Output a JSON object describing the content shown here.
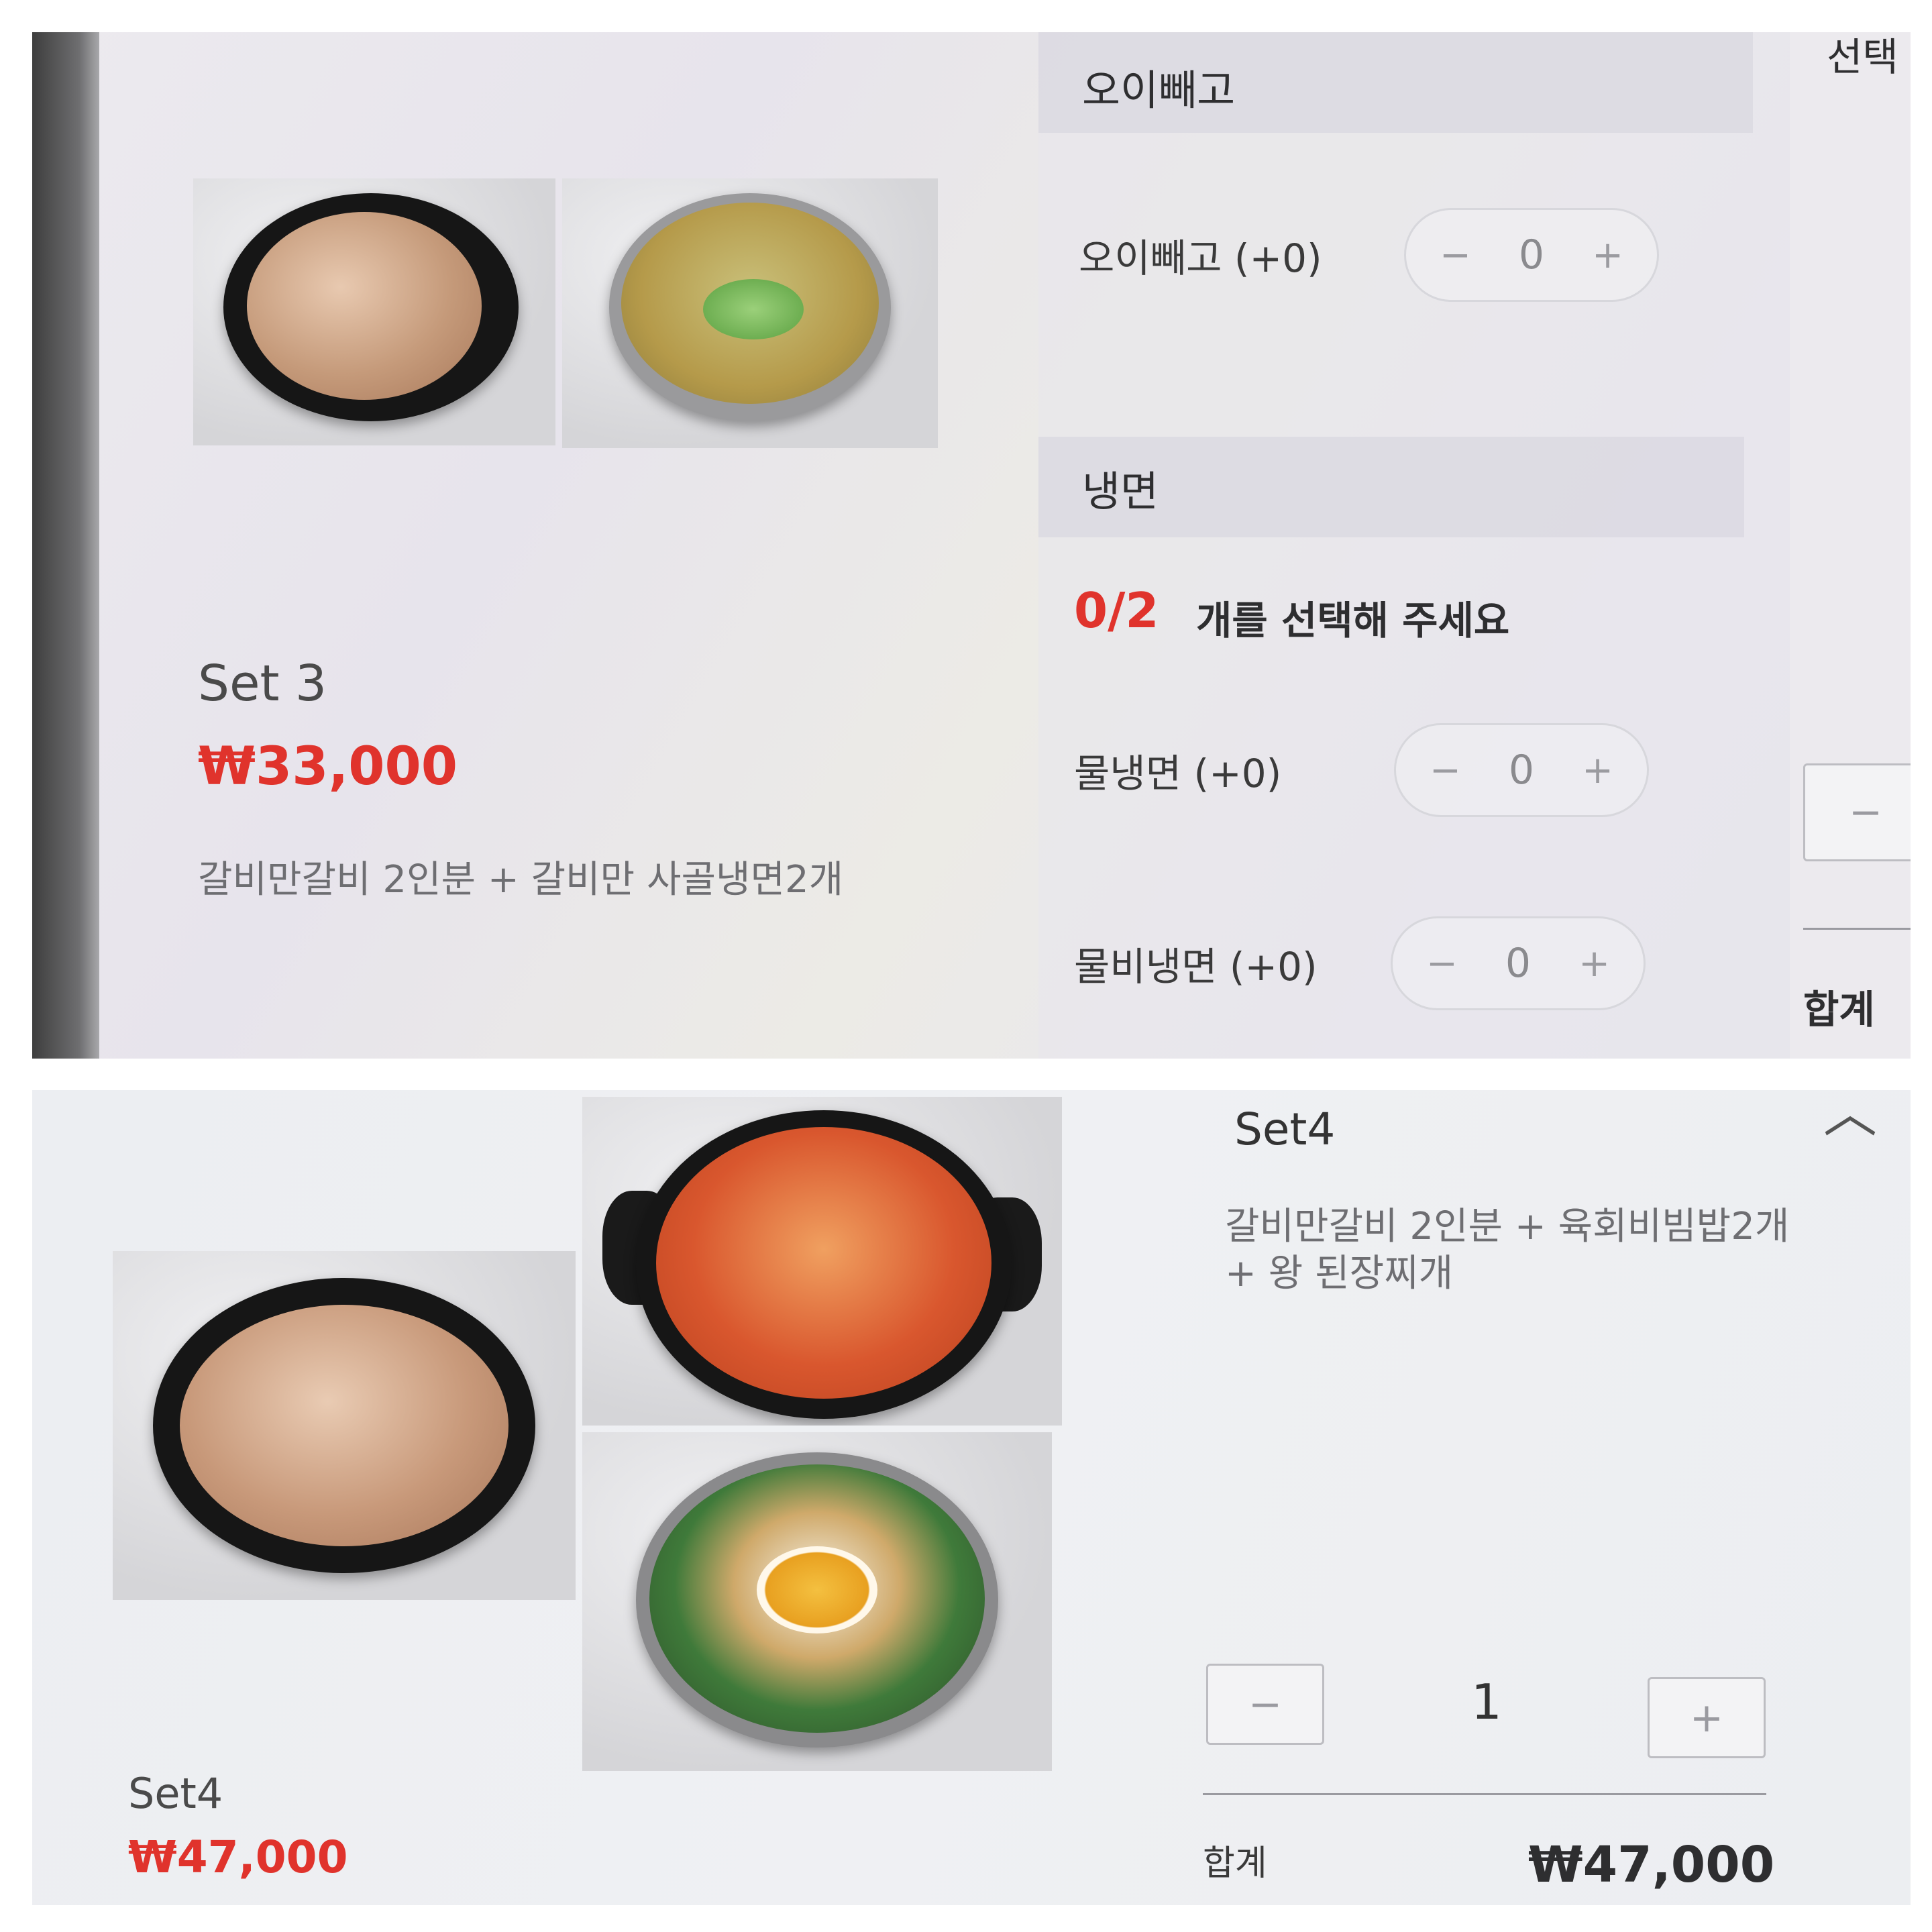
{
  "top": {
    "set_title": "Set 3",
    "set_price": "₩33,000",
    "set_description": "갈비만갈비 2인분 + 갈비만 사골냉면2개",
    "header_clipped": "선택",
    "section1": {
      "header": "오이빼고",
      "options": [
        {
          "label": "오이빼고 (+0)",
          "count": "0"
        }
      ]
    },
    "section2": {
      "header": "냉면",
      "required_count": "0/2",
      "required_text": "개를 선택해 주세요",
      "options": [
        {
          "label": "물냉면 (+0)",
          "count": "0"
        },
        {
          "label": "물비냉면 (+0)",
          "count": "0"
        }
      ]
    },
    "side_minus": "−",
    "side_total_label": "합계",
    "minus_symbol": "−",
    "plus_symbol": "+"
  },
  "bottom": {
    "set_title": "Set4",
    "set_price": "₩47,000",
    "detail_title": "Set4",
    "detail_desc_line1": "갈비만갈비 2인분 + 육회비빔밥2개",
    "detail_desc_line2": "+ 왕 된장찌개",
    "quantity": "1",
    "minus_symbol": "−",
    "plus_symbol": "+",
    "total_label": "합계",
    "total_value": "₩47,000",
    "close_symbol": "︿"
  },
  "colors": {
    "accent_red": "#e0332c",
    "text_dark": "#3a3a3a",
    "text_gray": "#6e6e72"
  }
}
